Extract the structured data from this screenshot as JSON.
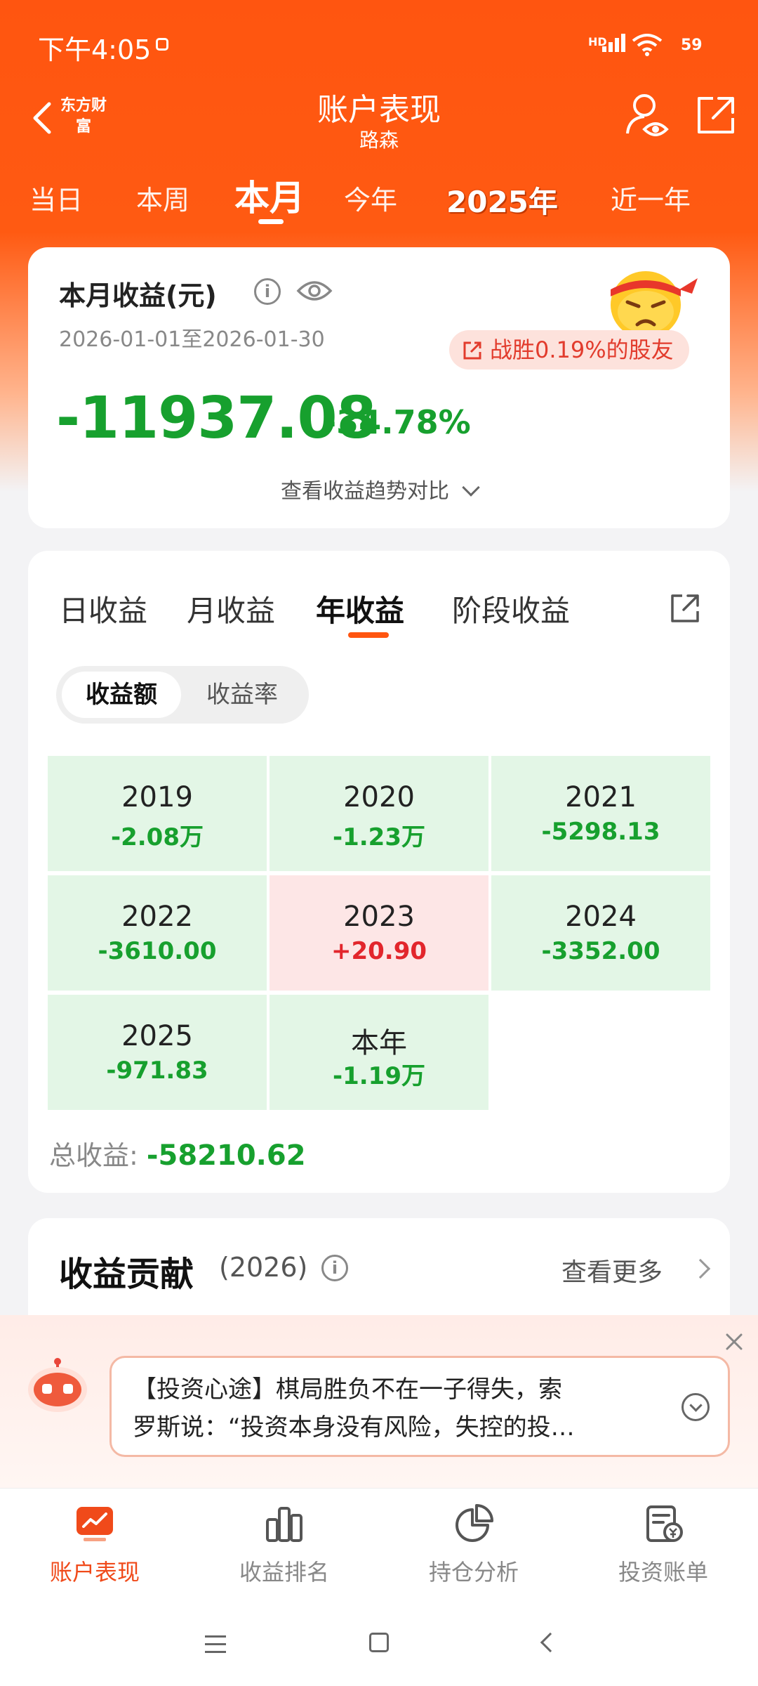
{
  "status_bar": {
    "time": "下午4:05",
    "network": "HD",
    "battery": "59"
  },
  "header": {
    "logo": "东方财富",
    "title": "账户表现",
    "subtitle": "路森"
  },
  "periods": [
    "当日",
    "本周",
    "本月",
    "今年",
    "2025年",
    "近一年"
  ],
  "active_period": "本月",
  "summary": {
    "label": "本月收益(元)",
    "date_range": "2026-01-01至2026-01-30",
    "beat_text": "战胜0.19%的股友",
    "amount": "-11937.08",
    "percent": "-34.78%",
    "trend_link": "查看收益趋势对比"
  },
  "earnings": {
    "tabs": [
      "日收益",
      "月收益",
      "年收益",
      "阶段收益"
    ],
    "active_tab": "年收益",
    "segments": [
      "收益额",
      "收益率"
    ],
    "active_segment": "收益额",
    "cells": [
      {
        "year": "2019",
        "value": "-2.08万",
        "tone": "negative"
      },
      {
        "year": "2020",
        "value": "-1.23万",
        "tone": "negative"
      },
      {
        "year": "2021",
        "value": "-5298.13",
        "tone": "negative"
      },
      {
        "year": "2022",
        "value": "-3610.00",
        "tone": "negative"
      },
      {
        "year": "2023",
        "value": "+20.90",
        "tone": "positive"
      },
      {
        "year": "2024",
        "value": "-3352.00",
        "tone": "negative"
      },
      {
        "year": "2025",
        "value": "-971.83",
        "tone": "negative"
      },
      {
        "year": "本年",
        "value": "-1.19万",
        "tone": "negative"
      }
    ],
    "total_label": "总收益:",
    "total_value": "-58210.62"
  },
  "contribution": {
    "title": "收益贡献",
    "year": "(2026)",
    "more": "查看更多"
  },
  "notice": {
    "line1": "【投资心途】棋局胜负不在一子得失，索",
    "line2": "罗斯说：“投资本身没有风险，失控的投…"
  },
  "bottom_nav": [
    "账户表现",
    "收益排名",
    "持仓分析",
    "投资账单"
  ],
  "active_nav": "账户表现",
  "colors": {
    "brand": "#ff5510",
    "loss": "#17a02e",
    "gain": "#e2262c"
  },
  "icons": {
    "header": [
      "back-icon",
      "user-view-icon",
      "share-icon"
    ],
    "nav": [
      "account-chart-icon",
      "ranking-icon",
      "pie-chart-icon",
      "bill-icon"
    ]
  }
}
